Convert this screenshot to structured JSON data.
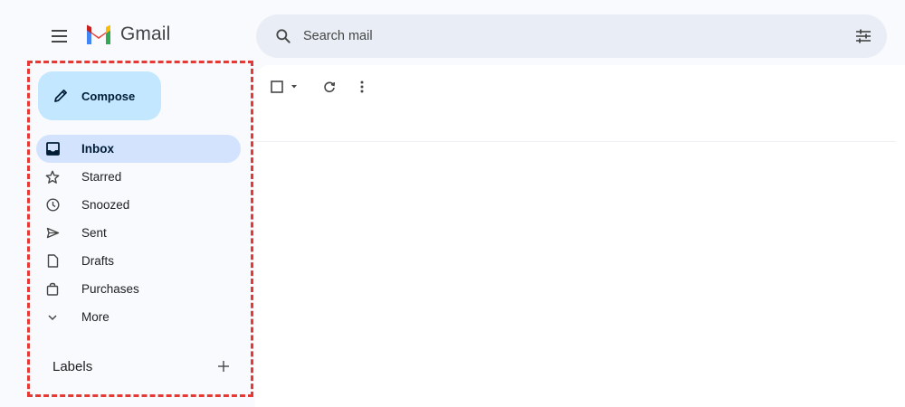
{
  "app": {
    "name": "Gmail"
  },
  "search": {
    "placeholder": "Search mail"
  },
  "compose": {
    "label": "Compose"
  },
  "nav": {
    "items": [
      {
        "label": "Inbox",
        "icon": "inbox-icon",
        "active": true
      },
      {
        "label": "Starred",
        "icon": "star-icon"
      },
      {
        "label": "Snoozed",
        "icon": "clock-icon"
      },
      {
        "label": "Sent",
        "icon": "send-icon"
      },
      {
        "label": "Drafts",
        "icon": "draft-icon"
      },
      {
        "label": "Purchases",
        "icon": "shopping-bag-icon"
      },
      {
        "label": "More",
        "icon": "chevron-down-icon"
      }
    ]
  },
  "labels": {
    "title": "Labels",
    "add": "+"
  },
  "colors": {
    "compose_bg": "#c2e7ff",
    "active_bg": "#d3e3fd",
    "search_bg": "#e9eef6",
    "highlight_outline": "#e53935"
  }
}
